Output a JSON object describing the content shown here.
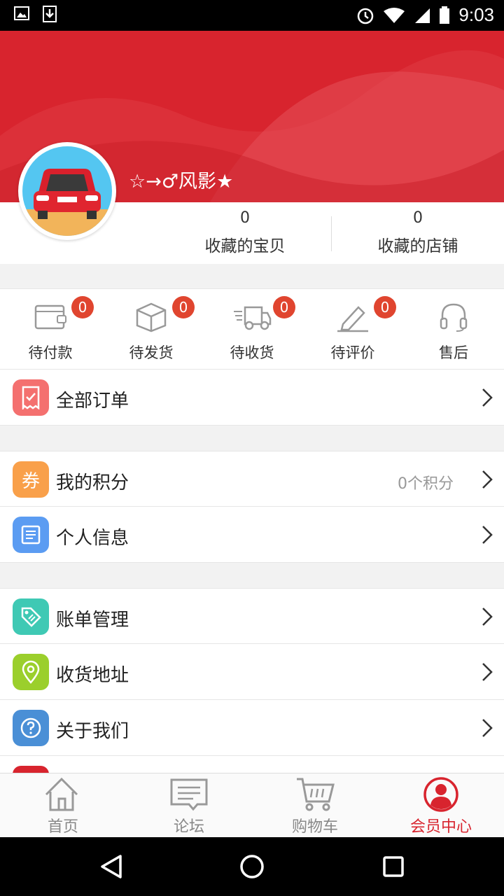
{
  "status": {
    "time": "9:03"
  },
  "profile": {
    "username": "☆→♂风影★",
    "stats": [
      {
        "value": "0",
        "label": "收藏的宝贝"
      },
      {
        "value": "0",
        "label": "收藏的店铺"
      }
    ]
  },
  "orders": [
    {
      "label": "待付款",
      "badge": "0",
      "icon": "wallet-icon"
    },
    {
      "label": "待发货",
      "badge": "0",
      "icon": "package-icon"
    },
    {
      "label": "待收货",
      "badge": "0",
      "icon": "delivery-truck-icon"
    },
    {
      "label": "待评价",
      "badge": "0",
      "icon": "pencil-icon"
    },
    {
      "label": "售后",
      "icon": "headset-icon"
    }
  ],
  "menu": {
    "all_orders": {
      "label": "全部订单",
      "icon": "receipt-icon",
      "color": "#f4706f"
    },
    "points": {
      "label": "我的积分",
      "icon": "coupon-icon",
      "icon_text": "券",
      "extra": "0个积分",
      "color": "#f9a04a"
    },
    "personal_info": {
      "label": "个人信息",
      "icon": "id-card-icon",
      "color": "#5b9cf2"
    },
    "bills": {
      "label": "账单管理",
      "icon": "tag-icon",
      "color": "#3fc9b4"
    },
    "address": {
      "label": "收货地址",
      "icon": "location-pin-icon",
      "color": "#9bcf2c"
    },
    "about": {
      "label": "关于我们",
      "icon": "question-icon",
      "color": "#4a8fd6"
    }
  },
  "tabs": [
    {
      "label": "首页",
      "icon": "home-icon"
    },
    {
      "label": "论坛",
      "icon": "forum-icon"
    },
    {
      "label": "购物车",
      "icon": "cart-icon"
    },
    {
      "label": "会员中心",
      "icon": "member-icon",
      "active": true
    }
  ],
  "colors": {
    "brand": "#d8242e",
    "badge": "#e0452f"
  }
}
